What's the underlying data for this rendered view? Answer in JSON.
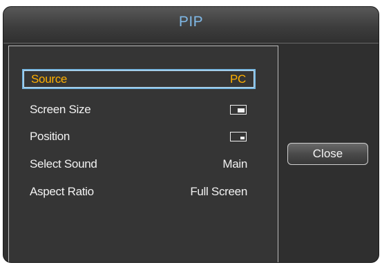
{
  "dialog": {
    "title": "PIP"
  },
  "menu": {
    "items": [
      {
        "label": "Source",
        "value": "PC",
        "selected": true
      },
      {
        "label": "Screen Size",
        "icon": "pip-large-window-icon"
      },
      {
        "label": "Position",
        "icon": "pip-bottom-right-position-icon"
      },
      {
        "label": "Select Sound",
        "value": "Main"
      },
      {
        "label": "Aspect Ratio",
        "value": "Full Screen"
      }
    ]
  },
  "buttons": {
    "close_label": "Close"
  },
  "colors": {
    "title": "#7fb8e6",
    "selected_text": "#ffb000",
    "selection_border": "#7ab9e3",
    "panel_background": "#353535"
  }
}
